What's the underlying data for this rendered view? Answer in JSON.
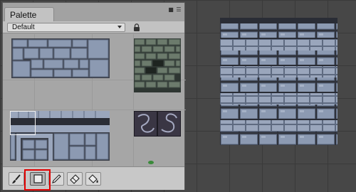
{
  "window": {
    "title": "Palette"
  },
  "palette_select": {
    "value": "Default"
  },
  "tools": [
    {
      "name": "brush",
      "icon": "brush-icon",
      "selected": false
    },
    {
      "name": "box-fill",
      "icon": "box-fill-icon",
      "selected": true
    },
    {
      "name": "picker",
      "icon": "picker-icon",
      "selected": false
    },
    {
      "name": "eraser",
      "icon": "eraser-icon",
      "selected": false
    },
    {
      "name": "fill",
      "icon": "bucket-fill-icon",
      "selected": false
    }
  ],
  "colors": {
    "highlight": "#e00000",
    "stone": "#8c9ab2",
    "mortar": "#3a3e48",
    "moss": "#6c7b6c",
    "grid": "#474747"
  }
}
